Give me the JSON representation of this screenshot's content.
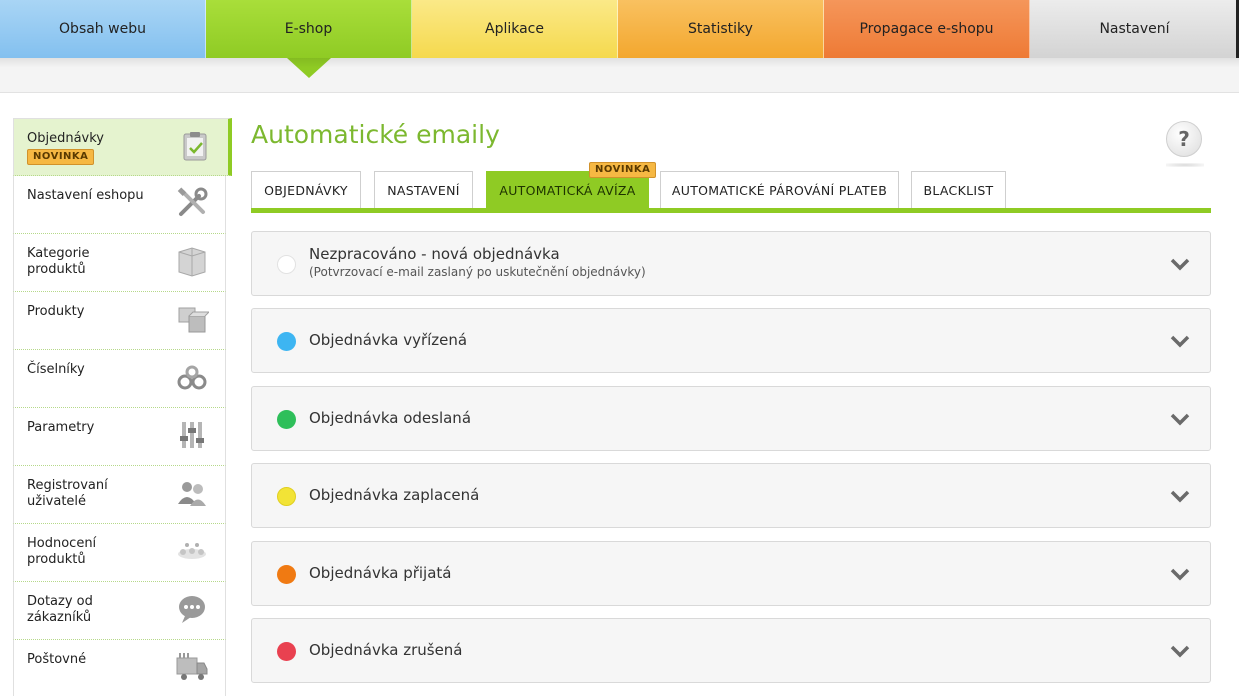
{
  "topnav": [
    {
      "label": "Obsah webu",
      "color": "#83c0ef"
    },
    {
      "label": "E-shop",
      "color": "#8fcb24"
    },
    {
      "label": "Aplikace",
      "color": "#f5d94e"
    },
    {
      "label": "Statistiky",
      "color": "#f3a72e"
    },
    {
      "label": "Propagace e-shopu",
      "color": "#ee7a35"
    },
    {
      "label": "Nastavení",
      "color": "#d3d3d3"
    }
  ],
  "sidebar": {
    "items": [
      {
        "label": "Objednávky",
        "badge": "NOVINKA",
        "icon": "clipboard-icon"
      },
      {
        "label": "Nastavení eshopu",
        "icon": "tools-icon"
      },
      {
        "label": "Kategorie produktů",
        "icon": "category-icon"
      },
      {
        "label": "Produkty",
        "icon": "boxes-icon"
      },
      {
        "label": "Číselníky",
        "icon": "gears-icon"
      },
      {
        "label": "Parametry",
        "icon": "sliders-icon"
      },
      {
        "label": "Registrovaní uživatelé",
        "icon": "users-icon"
      },
      {
        "label": "Hodnocení produktů",
        "icon": "rating-icon"
      },
      {
        "label": "Dotazy od zákazníků",
        "icon": "chat-icon"
      },
      {
        "label": "Poštovné",
        "icon": "truck-icon"
      }
    ]
  },
  "main": {
    "title": "Automatické emaily",
    "help": "?",
    "tabs": [
      {
        "label": "OBJEDNÁVKY"
      },
      {
        "label": "NASTAVENÍ"
      },
      {
        "label": "AUTOMATICKÁ AVÍZA",
        "badge": "NOVINKA"
      },
      {
        "label": "AUTOMATICKÉ PÁROVÁNÍ PLATEB"
      },
      {
        "label": "BLACKLIST"
      }
    ],
    "items": [
      {
        "name": "Nezpracováno - nová objednávka",
        "sub": "(Potvrzovací e-mail zaslaný po uskutečnění objednávky)",
        "color": "#ffffff"
      },
      {
        "name": "Objednávka vyřízená",
        "color": "#3db5f2"
      },
      {
        "name": "Objednávka odeslaná",
        "color": "#2ebf5a"
      },
      {
        "name": "Objednávka zaplacená",
        "color": "#f2e336"
      },
      {
        "name": "Objednávka přijatá",
        "color": "#f07a12"
      },
      {
        "name": "Objednávka zrušená",
        "color": "#e94150"
      }
    ]
  }
}
